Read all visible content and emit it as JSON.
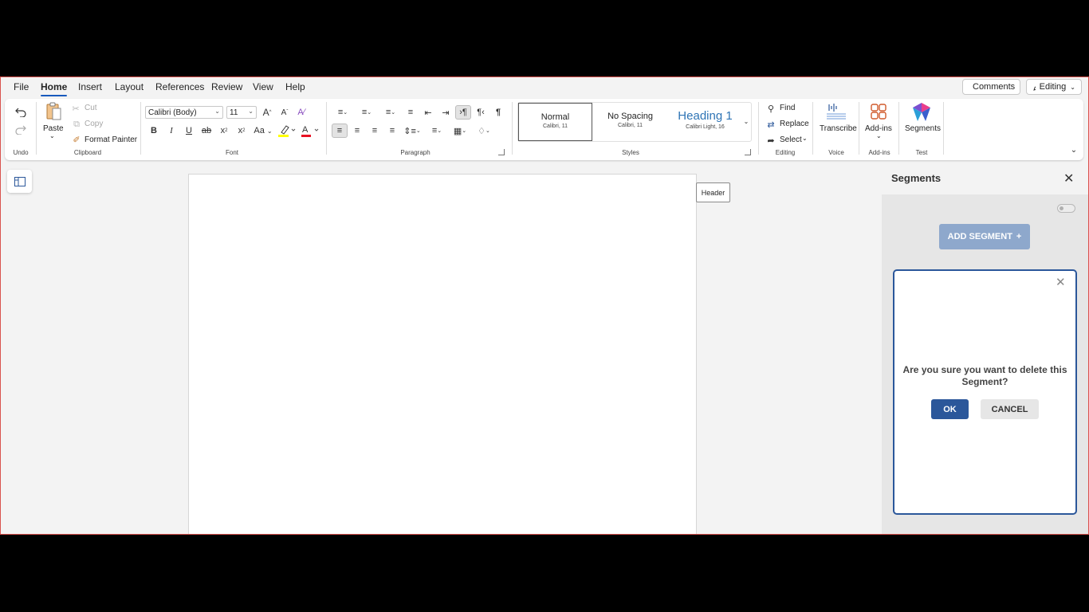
{
  "menu": {
    "tabs": [
      "File",
      "Home",
      "Insert",
      "Layout",
      "References",
      "Review",
      "View",
      "Help"
    ],
    "active_tab": "Home",
    "comments_label": "Comments",
    "editing_label": "Editing"
  },
  "ribbon": {
    "groups": [
      "Undo",
      "Clipboard",
      "Font",
      "Paragraph",
      "Styles",
      "Editing",
      "Voice",
      "Add-ins",
      "Test"
    ],
    "clipboard": {
      "paste": "Paste",
      "cut": "Cut",
      "copy": "Copy",
      "format_painter": "Format Painter"
    },
    "font": {
      "name": "Calibri (Body)",
      "size": "11",
      "case_label": "Aa"
    },
    "styles": [
      {
        "name": "Normal",
        "sub": "Calibri, 11"
      },
      {
        "name": "No Spacing",
        "sub": "Calibri, 11"
      },
      {
        "name": "Heading 1",
        "sub": "Calibri Light, 16"
      }
    ],
    "editing": {
      "find": "Find",
      "replace": "Replace",
      "select": "Select"
    },
    "voice": {
      "transcribe": "Transcribe"
    },
    "addins": {
      "label": "Add-ins"
    },
    "test": {
      "segments": "Segments"
    }
  },
  "document": {
    "header_tag": "Header"
  },
  "pane": {
    "title": "Segments",
    "add_segment_label": "ADD SEGMENT",
    "add_icon": "+",
    "dialog": {
      "message": "Are you sure you want to delete this Segment?",
      "ok": "OK",
      "cancel": "CANCEL"
    }
  },
  "colors": {
    "accent": "#2b579a",
    "tab_underline": "#185abd",
    "add_button": "#8ea8cc",
    "highlight": "#ffff00",
    "font_color": "#e81123"
  }
}
